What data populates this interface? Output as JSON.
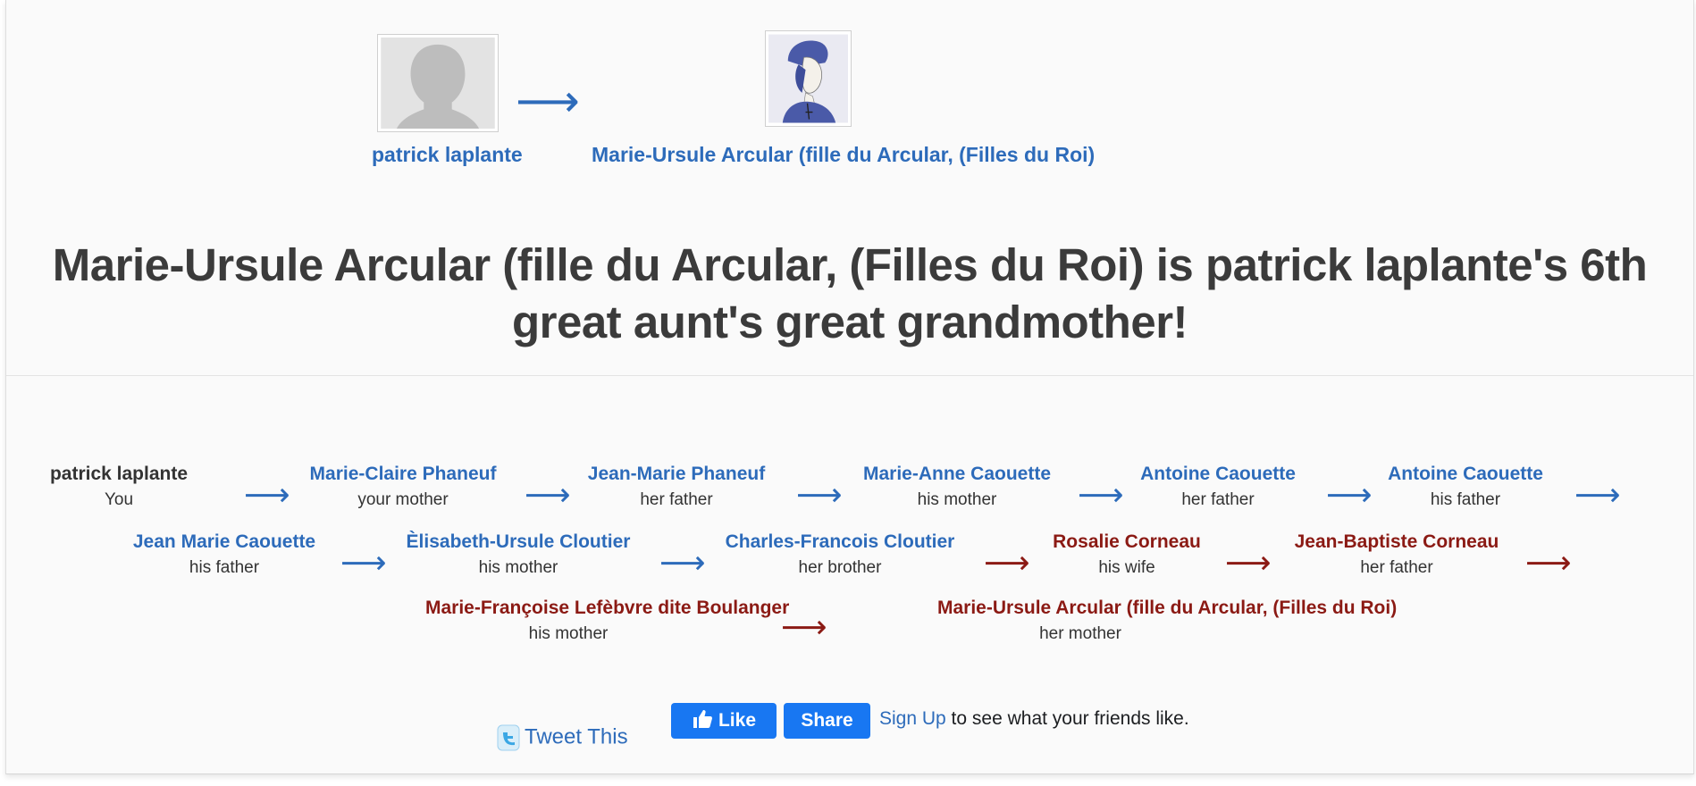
{
  "header": {
    "from_person": {
      "name": "patrick laplante"
    },
    "to_person": {
      "name": "Marie-Ursule Arcular (fille du Arcular, (Filles du Roi)"
    },
    "arrow": "⟶"
  },
  "headline": "Marie-Ursule Arcular (fille du Arcular, (Filles du Roi) is patrick laplante's 6th great aunt's great grandmother!",
  "chain": [
    {
      "name": "patrick laplante",
      "relation": "You"
    },
    {
      "name": "Marie-Claire Phaneuf",
      "relation": "your mother"
    },
    {
      "name": "Jean-Marie Phaneuf",
      "relation": "her father"
    },
    {
      "name": "Marie-Anne Caouette",
      "relation": "his mother"
    },
    {
      "name": "Antoine Caouette",
      "relation": "her father"
    },
    {
      "name": "Antoine Caouette",
      "relation": "his father"
    },
    {
      "name": "Jean Marie Caouette",
      "relation": "his father"
    },
    {
      "name": "Èlisabeth-Ursule Cloutier",
      "relation": "his mother"
    },
    {
      "name": "Charles-Francois Cloutier",
      "relation": "her brother"
    },
    {
      "name": "Rosalie Corneau",
      "relation": "his wife"
    },
    {
      "name": "Jean-Baptiste Corneau",
      "relation": "her father"
    },
    {
      "name": "Marie-Françoise Lefèbvre dite Boulanger",
      "relation": "his mother"
    },
    {
      "name": "Marie-Ursule Arcular (fille du Arcular, (Filles du Roi)",
      "relation": "her mother"
    }
  ],
  "arrows": {
    "glyph": "⟶"
  },
  "colors": {
    "blood": "#2d6bba",
    "marriage": "#8b1a14",
    "self": "#333333",
    "facebook": "#1877f2"
  },
  "social": {
    "tweet_label": "Tweet This",
    "like_label": "Like",
    "share_label": "Share",
    "signup_link": "Sign Up",
    "signup_text": " to see what your friends like."
  }
}
